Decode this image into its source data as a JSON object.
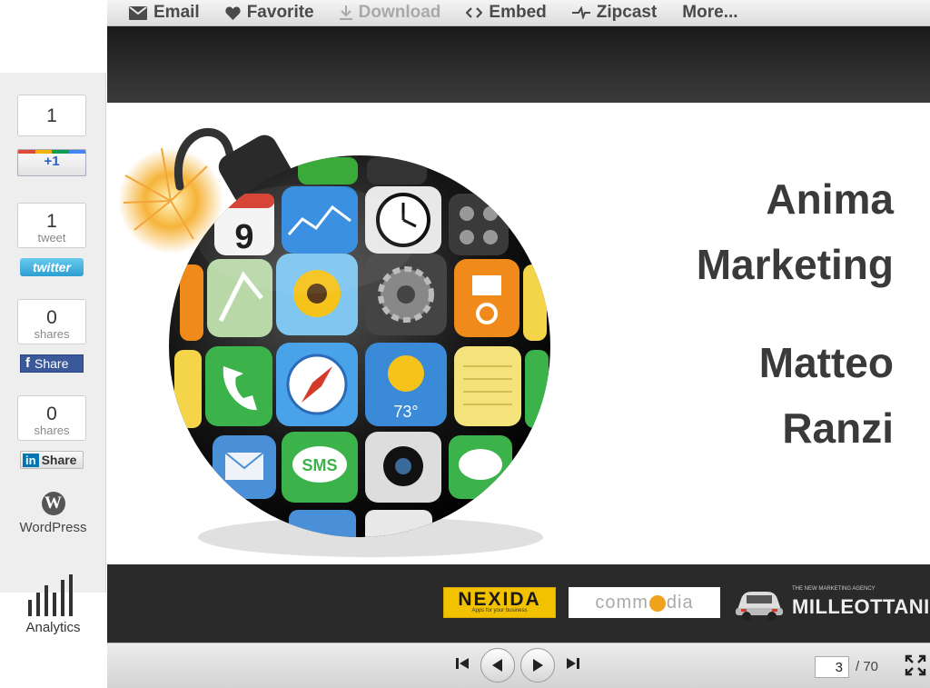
{
  "toolbar": {
    "email": "Email",
    "favorite": "Favorite",
    "download": "Download",
    "embed": "Embed",
    "zipcast": "Zipcast",
    "more": "More..."
  },
  "social": {
    "gplus_count": "1",
    "gplus_label": "+1",
    "tweet_count": "1",
    "tweet_label": "tweet",
    "twitter_button": "twitter",
    "fb_count": "0",
    "fb_sub": "shares",
    "fb_button": "Share",
    "li_count": "0",
    "li_sub": "shares",
    "li_button": "Share",
    "li_logo": "in",
    "wordpress": "WordPress",
    "analytics": "Analytics"
  },
  "slide": {
    "line1": "Anima",
    "line2": "Marketing",
    "line3": "Matteo",
    "line4": "Ranzi",
    "sms_label": "SMS",
    "temp_label": "73°",
    "calendar_day": "9"
  },
  "footer_logos": {
    "nexida": "NEXIDA",
    "nexida_tag": "Apps for your business",
    "commedia": "comm",
    "commedia_tail": "dia",
    "milleottani_small": "THE NEW MARKETING AGENCY",
    "milleottani": "MILLEOTTANI"
  },
  "pager": {
    "current": "3",
    "total": "/ 70"
  },
  "colors": {
    "gplus_blue": "#2a5fc8",
    "twitter": "#2c9fd1",
    "facebook": "#3b5998",
    "linkedin": "#0077b5",
    "nexida_yellow": "#f2c200"
  }
}
